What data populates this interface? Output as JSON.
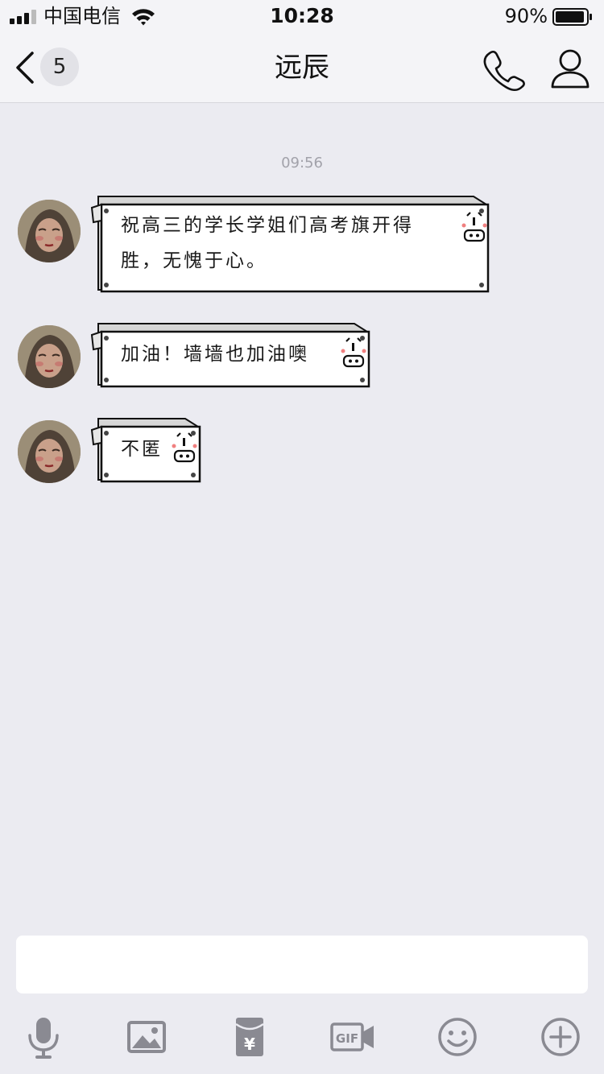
{
  "status_bar": {
    "carrier": "中国电信",
    "time": "10:28",
    "battery_percent": "90%"
  },
  "nav": {
    "back_badge": "5",
    "title": "远辰"
  },
  "chat": {
    "timestamp": "09:56",
    "messages": [
      {
        "sender": "远辰",
        "lines": [
          "祝高三的学长学姐们高考旗开得",
          "胜，无愧于心。"
        ]
      },
      {
        "sender": "远辰",
        "lines": [
          "加油！墙墙也加油噢"
        ]
      },
      {
        "sender": "远辰",
        "lines": [
          "不匿"
        ]
      }
    ]
  },
  "toolbar": {
    "icons": [
      "microphone-icon",
      "image-icon",
      "red-packet-icon",
      "gif-icon",
      "emoji-icon",
      "plus-icon"
    ],
    "gif_label": "GIF",
    "red_packet_symbol": "¥"
  },
  "colors": {
    "background": "#ebebf1",
    "bar": "#f4f4f7",
    "icon_gray": "#8a8a92"
  }
}
